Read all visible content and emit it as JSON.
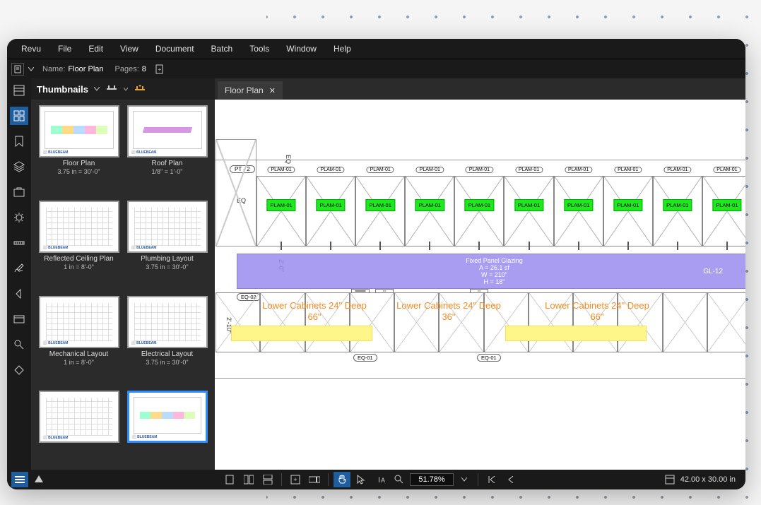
{
  "menu": {
    "items": [
      "Revu",
      "File",
      "Edit",
      "View",
      "Document",
      "Batch",
      "Tools",
      "Window",
      "Help"
    ]
  },
  "info": {
    "name_label": "Name:",
    "name_value": "Floor Plan",
    "pages_label": "Pages:",
    "pages_value": "8"
  },
  "thumbnails": {
    "title": "Thumbnails",
    "items": [
      {
        "label": "Floor Plan",
        "scale": "3.75 in = 30'-0\"",
        "kind": "floor"
      },
      {
        "label": "Roof Plan",
        "scale": "1/8\" = 1'-0\"",
        "kind": "roof"
      },
      {
        "label": "Reflected Ceiling Plan",
        "scale": "1 in = 8'-0\"",
        "kind": "grid"
      },
      {
        "label": "Plumbing Layout",
        "scale": "3.75 in = 30'-0\"",
        "kind": "grid"
      },
      {
        "label": "Mechanical Layout",
        "scale": "1 in = 8'-0\"",
        "kind": "grid"
      },
      {
        "label": "Electrical Layout",
        "scale": "3.75 in = 30'-0\"",
        "kind": "grid"
      },
      {
        "label": "",
        "scale": "",
        "kind": "grid"
      },
      {
        "label": "",
        "scale": "",
        "kind": "floor",
        "selected": true
      }
    ]
  },
  "tab": {
    "label": "Floor Plan"
  },
  "drawing": {
    "pt_tag": "PT - 2",
    "eq": "EQ",
    "plam_pill": "PLAM-01",
    "plam_box": "PLAM-01",
    "plam_count": 10,
    "glazing": {
      "l1": "Fixed Panel Glazing",
      "l2": "A = 26.1 sf",
      "l3": "W = 210\"",
      "l4": "H = 18\"",
      "tag": "GL-12"
    },
    "dim24": "2'-0\"",
    "dim210": "2'-10\"",
    "lower_labels": [
      {
        "t": "Lower Cabinets 24\" Deep",
        "h": "66\""
      },
      {
        "t": "Lower Cabinets 24\" Deep",
        "h": "36\""
      },
      {
        "t": "Lower Cabinets 24\" Deep",
        "h": "66\""
      }
    ],
    "eq_tags": {
      "eq02": "EQ-02",
      "eq01": "EQ-01"
    }
  },
  "status": {
    "zoom": "51.78%",
    "dims": "42.00 x 30.00 in"
  }
}
